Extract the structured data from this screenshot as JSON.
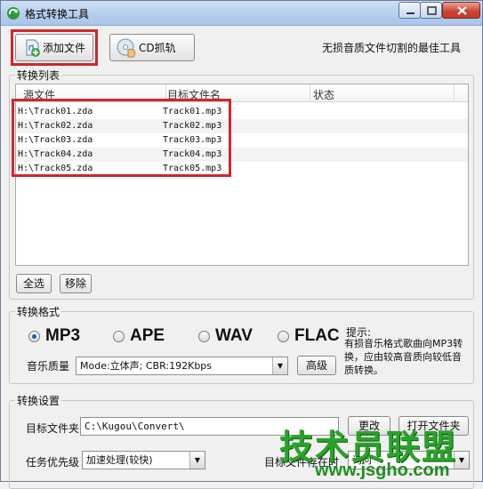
{
  "window": {
    "title": "格式转换工具"
  },
  "toolbar": {
    "add_file": "添加文件",
    "cd_rip": "CD抓轨",
    "slogan": "无损音质文件切割的最佳工具"
  },
  "list": {
    "group_label": "转换列表",
    "columns": [
      "源文件",
      "目标文件名",
      "状态"
    ],
    "rows": [
      {
        "src": "H:\\Track01.zda",
        "dst": "Track01.mp3",
        "status": ""
      },
      {
        "src": "H:\\Track02.zda",
        "dst": "Track02.mp3",
        "status": ""
      },
      {
        "src": "H:\\Track03.zda",
        "dst": "Track03.mp3",
        "status": ""
      },
      {
        "src": "H:\\Track04.zda",
        "dst": "Track04.mp3",
        "status": ""
      },
      {
        "src": "H:\\Track05.zda",
        "dst": "Track05.mp3",
        "status": ""
      }
    ],
    "select_all": "全选",
    "remove": "移除"
  },
  "format": {
    "group_label": "转换格式",
    "options": [
      {
        "label": "MP3",
        "selected": true
      },
      {
        "label": "APE",
        "selected": false
      },
      {
        "label": "WAV",
        "selected": false
      },
      {
        "label": "FLAC",
        "selected": false
      }
    ],
    "quality_label": "音乐质量",
    "quality_value": "Mode:立体声; CBR:192Kbps",
    "advanced": "高级",
    "hint_title": "提示:",
    "hint_body": "有损音乐格式歌曲向MP3转换，应由较高音质向较低音质转换。"
  },
  "settings": {
    "group_label": "转换设置",
    "target_folder_label": "目标文件夹",
    "target_folder_value": "C:\\Kugou\\Convert\\",
    "change": "更改",
    "open_folder": "打开文件夹",
    "priority_label": "任务优先级",
    "priority_value": "加速处理(较快)",
    "exists_label": "目标文件存在时",
    "exists_value": "询问"
  },
  "watermark": {
    "text": "技术员联盟",
    "url": "www.jsgho.com"
  },
  "colors": {
    "highlight": "#d1262b",
    "accent": "#1c5fb8",
    "watermark": "#2aa32a"
  }
}
